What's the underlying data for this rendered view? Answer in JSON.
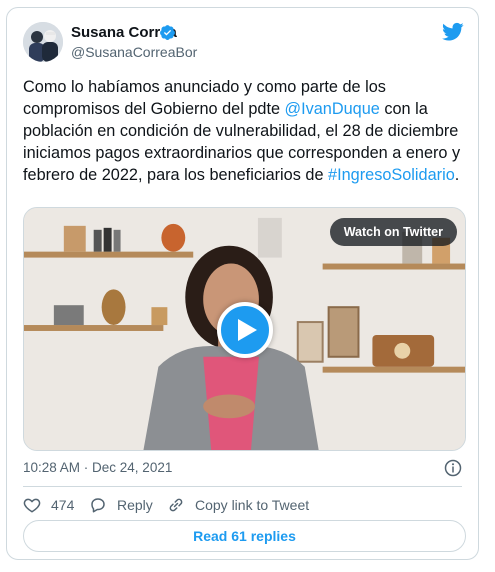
{
  "author": {
    "name": "Susana Correa",
    "handle": "@SusanaCorreaBor",
    "verified": true
  },
  "tweet": {
    "text_part1": "Como lo habíamos anunciado y como parte de los compromisos del Gobierno del pdte ",
    "mention": "@IvanDuque",
    "text_part2": " con la población en condición de vulnerabilidad, el 28 de diciembre iniciamos pagos extraordinarios que corresponden a enero y febrero de 2022, para los beneficiarios de ",
    "hashtag": "#IngresoSolidario",
    "text_part3": "."
  },
  "media": {
    "watch_label": "Watch on Twitter"
  },
  "meta": {
    "timestamp": "10:28 AM · Dec 24, 2021"
  },
  "actions": {
    "like_count": "474",
    "reply_label": "Reply",
    "copy_label": "Copy link to Tweet",
    "read_replies_label": "Read 61 replies"
  },
  "colors": {
    "accent": "#1d9bf0",
    "text": "#0f1419",
    "secondary": "#536471",
    "border": "#cfd9de"
  },
  "icons": [
    "verified-badge-icon",
    "twitter-bird-icon",
    "play-icon",
    "info-icon",
    "heart-icon",
    "reply-icon",
    "link-icon"
  ]
}
